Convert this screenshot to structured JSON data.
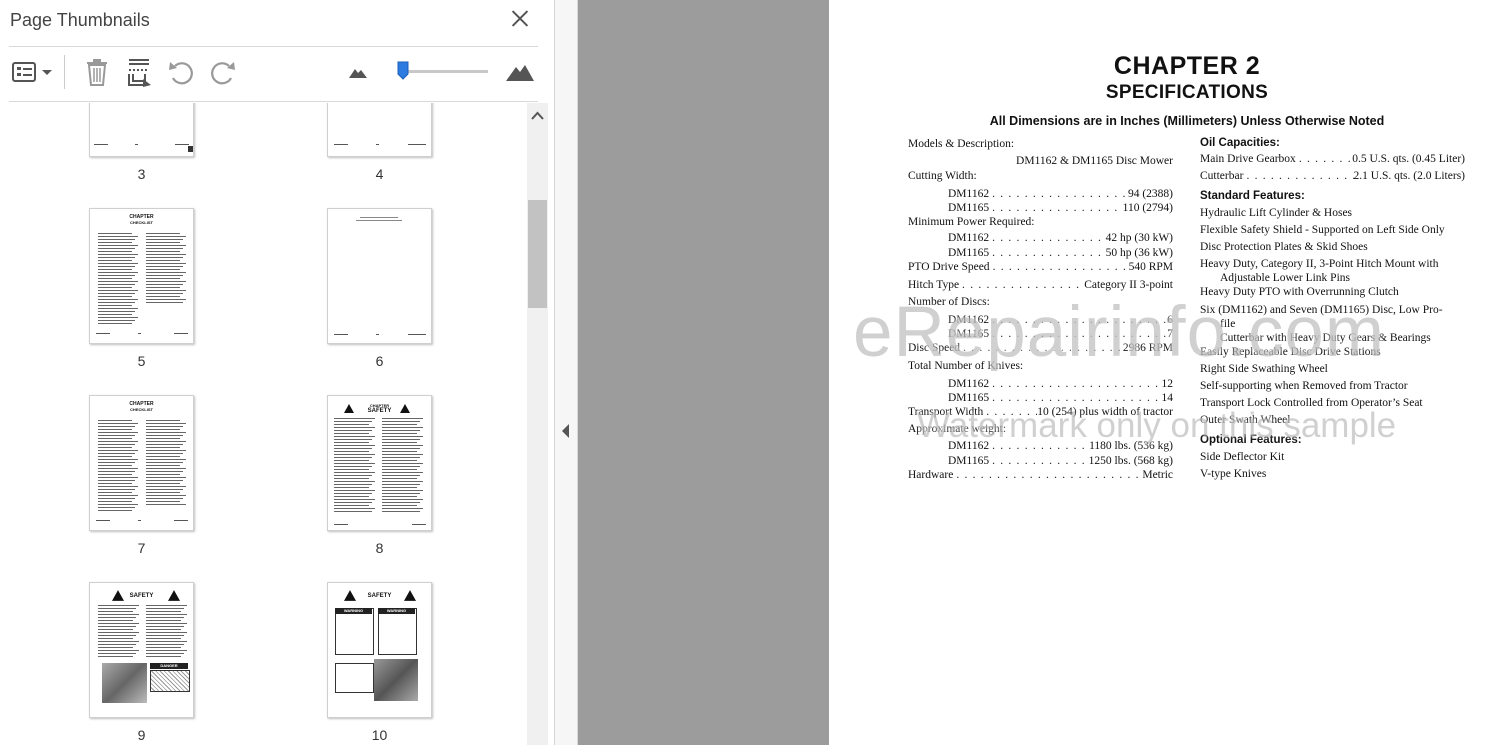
{
  "panel": {
    "title": "Page Thumbnails",
    "close_label": "Close",
    "toolbar": {
      "options_icon": "list-options-icon",
      "delete_icon": "trash-icon",
      "extract_icon": "page-extract-icon",
      "rotate_ccw_icon": "rotate-left-icon",
      "rotate_cw_icon": "rotate-right-icon",
      "zoom_out_icon": "mountain-small-icon",
      "zoom_in_icon": "mountain-large-icon",
      "zoom_fraction": 0.05
    },
    "thumbnails": [
      {
        "page": "3"
      },
      {
        "page": "4"
      },
      {
        "page": "5"
      },
      {
        "page": "6"
      },
      {
        "page": "7"
      },
      {
        "page": "8"
      },
      {
        "page": "9"
      },
      {
        "page": "10"
      }
    ],
    "thumb_text": {
      "chapter_caps": "CHAPTER",
      "checklist": "CHECKLIST",
      "safety_caps": "SAFETY",
      "danger": "DANGER",
      "warning": "WARNING",
      "caution": "CAUTION"
    }
  },
  "accent_color": "#2d7be0",
  "document": {
    "chapter": "CHAPTER 2",
    "heading": "SPECIFICATIONS",
    "dimensions_note": "All Dimensions are in Inches (Millimeters) Unless Otherwise Noted",
    "left_column": [
      {
        "label": "Models & Description:"
      },
      {
        "value": "DM1162 & DM1165 Disc Mower"
      },
      {
        "label": "Cutting Width:"
      },
      {
        "label": "DM1162",
        "value": "94 (2388)"
      },
      {
        "label": "DM1165",
        "value": "110 (2794)"
      },
      {
        "label": "Minimum Power Required:"
      },
      {
        "label": "DM1162",
        "value": "42 hp (30 kW)"
      },
      {
        "label": "DM1165",
        "value": "50 hp (36 kW)"
      },
      {
        "label": "PTO Drive Speed",
        "value": "540 RPM"
      },
      {
        "label": "Hitch Type",
        "value": "Category II 3-point"
      },
      {
        "label": "Number of Discs:"
      },
      {
        "label": "DM1162",
        "value": "6"
      },
      {
        "label": "DM1165",
        "value": "7"
      },
      {
        "label": "Disc Speed",
        "value": "2986 RPM"
      },
      {
        "label": "Total Number of Knives:"
      },
      {
        "label": "DM1162",
        "value": "12"
      },
      {
        "label": "DM1165",
        "value": "14"
      },
      {
        "label": "Transport Width",
        "value": "10 (254) plus width of tractor"
      },
      {
        "label": "Approximate weight:"
      },
      {
        "label": "DM1162",
        "value": "1180 lbs. (536 kg)"
      },
      {
        "label": "DM1165",
        "value": "1250 lbs. (568 kg)"
      },
      {
        "label": "Hardware",
        "value": "Metric"
      }
    ],
    "right_column": {
      "oil_heading": "Oil Capacities:",
      "oil": [
        {
          "label": "Main Drive Gearbox",
          "value": "0.5 U.S. qts. (0.45 Liter)"
        },
        {
          "label": "Cutterbar",
          "value": "2.1 U.S. qts. (2.0 Liters)"
        }
      ],
      "standard_heading": "Standard Features:",
      "standard": [
        "Hydraulic Lift Cylinder & Hoses",
        "Flexible Safety Shield - Supported on Left Side Only",
        "Disc Protection Plates & Skid Shoes",
        "Heavy Duty, Category II, 3-Point Hitch  Mount with",
        "Adjustable Lower Link Pins",
        "Heavy Duty PTO with Overrunning Clutch",
        "Six (DM1162) and Seven (DM1165) Disc, Low Pro-",
        "file",
        "Cutterbar with Heavy Duty Gears & Bearings",
        "Easily Replaceable Disc Drive Stations",
        "Right Side Swathing Wheel",
        "Self-supporting when Removed from Tractor",
        "Transport Lock Controlled from Operator’s Seat",
        "Outer Swath Wheel"
      ],
      "optional_heading": "Optional Features:",
      "optional": [
        "Side Deflector Kit",
        "V-type Knives"
      ]
    },
    "watermark": "eRepairinfo.com",
    "watermark_sub": "Watermark only on this sample"
  }
}
